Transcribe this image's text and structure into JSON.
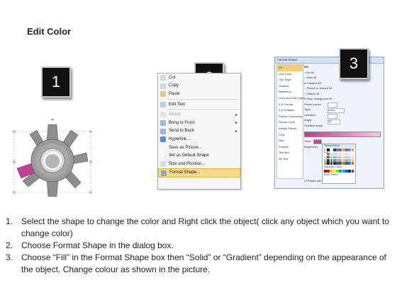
{
  "header": {
    "title": "Edit Color"
  },
  "steps": [
    {
      "number": "1"
    },
    {
      "number": "2"
    },
    {
      "number": "3"
    }
  ],
  "context_menu": {
    "items": [
      {
        "label": "Cut",
        "icon": "scissors-icon",
        "disabled": false
      },
      {
        "label": "Copy",
        "icon": "copy-icon",
        "disabled": false
      },
      {
        "label": "Paste",
        "icon": "paste-icon",
        "disabled": false
      },
      {
        "label": "Edit Text",
        "icon": "edit-text-icon",
        "disabled": false
      },
      {
        "label": "Group",
        "icon": "group-icon",
        "disabled": true,
        "submenu": true
      },
      {
        "label": "Bring to Front",
        "icon": "bring-front-icon",
        "disabled": false,
        "submenu": true
      },
      {
        "label": "Send to Back",
        "icon": "send-back-icon",
        "disabled": false,
        "submenu": true
      },
      {
        "label": "Hyperlink...",
        "icon": "hyperlink-icon",
        "disabled": false
      },
      {
        "label": "Save as Picture...",
        "icon": "",
        "disabled": false
      },
      {
        "label": "Set as Default Shape",
        "icon": "",
        "disabled": false
      },
      {
        "label": "Size and Position...",
        "icon": "size-icon",
        "disabled": false
      },
      {
        "label": "Format Shape...",
        "icon": "format-shape-icon",
        "disabled": false,
        "selected": true
      }
    ]
  },
  "format_dialog": {
    "title": "Format Shape",
    "categories": [
      "Fill",
      "Line Color",
      "Line Style",
      "Shadow",
      "Reflection",
      "Glow and Soft Edges",
      "3-D Format",
      "3-D Rotation",
      "Picture Corrections",
      "Picture Color",
      "Artistic Effects",
      "Crop",
      "Size",
      "Position",
      "Text Box",
      "Alt Text"
    ],
    "fill": {
      "heading": "Fill",
      "options": [
        "No fill",
        "Solid fill",
        "Gradient fill",
        "Picture or texture fill",
        "Pattern fill",
        "Slide background fill"
      ],
      "preset_label": "Preset colors:",
      "type_label": "Type:",
      "type_value": "Linear",
      "direction_label": "Direction:",
      "angle_label": "Angle:",
      "angle_value": "90°",
      "stops_label": "Gradient stops",
      "color_label": "Color",
      "brightness_label": "Brightness:",
      "rotate_label": "Rotate with shape"
    },
    "palette": {
      "theme_label": "Theme Colors",
      "standard_label": "Standard Colors",
      "more_label": "More Colors..."
    },
    "gradient_colors": [
      "#b43c8c",
      "#e58fc7",
      "#f1c8e3"
    ]
  },
  "instructions": [
    {
      "num": "1.",
      "text": "Select the shape to change the color and Right click the object( click any object which you want to change color)"
    },
    {
      "num": "2.",
      "text": "Choose Format Shape in the dialog box."
    },
    {
      "num": "3.",
      "text": "Choose “Fill” in the Format Shape box then “Solid” or “Gradient” depending on the appearance of the object. Change colour as shown in the picture."
    }
  ],
  "colors": {
    "badge": "#111111",
    "gear": "#8d8d8d",
    "gear_accent": "#c0448f",
    "menu_highlight": "#f9d98a"
  }
}
